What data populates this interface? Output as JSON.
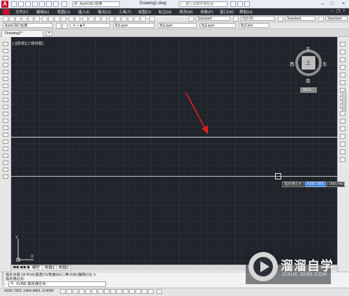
{
  "title_bar": {
    "workspace": "AutoCAD 经典",
    "document_title": "Drawing1.dwg",
    "search_placeholder": "键入关键字或短语"
  },
  "menu": [
    "文件(F)",
    "编辑(E)",
    "视图(V)",
    "插入(I)",
    "格式(O)",
    "工具(T)",
    "绘图(D)",
    "标注(N)",
    "修改(M)",
    "参数(P)",
    "窗口(W)",
    "帮助(H)"
  ],
  "toolbar": {
    "workspace_select": "AutoCAD 经典",
    "text_style": "Standard",
    "dim_style": "ISO-25",
    "table_style": "Standard",
    "multileader_style": "Standard",
    "layer_color": "ByLayer",
    "linetype": "ByLayer",
    "lineweight": "ByLayer",
    "plot_style": "ByColor"
  },
  "document_tab": "Drawing1*",
  "viewport": {
    "label": "[-][俯视][二维线框]",
    "viewcube": {
      "north": "北",
      "south": "南",
      "east": "东",
      "west": "西",
      "face": "上",
      "wcs": "WCS"
    }
  },
  "dynamic_input": {
    "prompt": "指定通过点:",
    "value1": "4100.7353",
    "value2": "1464.4401"
  },
  "layout_tabs": [
    "模型",
    "布局1",
    "布局2"
  ],
  "command": {
    "history1": "指定点或 [水平(H)/垂直(V)/角度(A)/二等分(B)/偏移(O)]: h",
    "history2": "指定通过点:",
    "current": "XLINE 指定通过点:"
  },
  "status": {
    "coordinates": "4100.7353, 1464.4401, 0.0000"
  },
  "watermark": {
    "name": "溜溜自学",
    "site": "ZIXUE.3D66.COM"
  },
  "colors": {
    "canvas": "#1f232a",
    "menubar": "#2b2f36",
    "accent": "#3d7fd8",
    "annotation_arrow": "#e02020"
  }
}
